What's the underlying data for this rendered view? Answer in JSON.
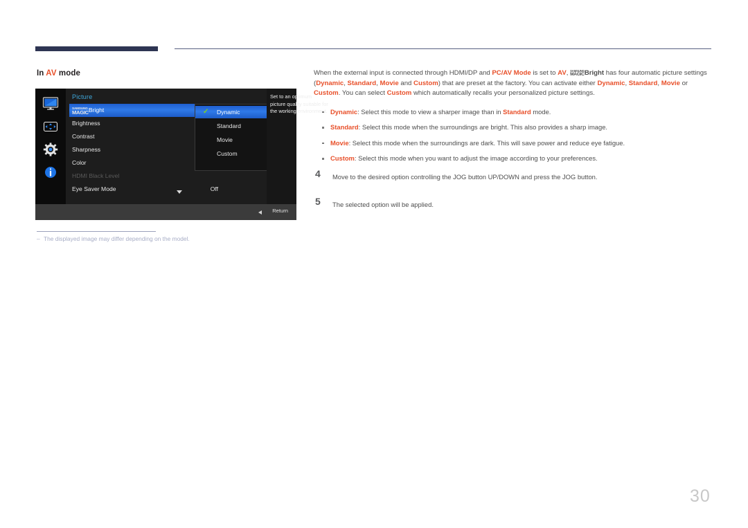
{
  "heading": {
    "prefix": "In ",
    "accent": "AV",
    "suffix": " mode"
  },
  "osd": {
    "title": "Picture",
    "sidebar_icons": [
      "monitor-icon",
      "screen-adjust-icon",
      "gear-icon",
      "info-icon"
    ],
    "menu_items": [
      {
        "label": "Bright",
        "logo": true,
        "logo_top": "SAMSUNG",
        "logo_bottom": "MAGIC",
        "state": "active",
        "value": ""
      },
      {
        "label": "Brightness",
        "state": "normal",
        "value": ""
      },
      {
        "label": "Contrast",
        "state": "normal",
        "value": ""
      },
      {
        "label": "Sharpness",
        "state": "normal",
        "value": ""
      },
      {
        "label": "Color",
        "state": "normal",
        "value": ""
      },
      {
        "label": "HDMI Black Level",
        "state": "disabled",
        "value": ""
      },
      {
        "label": "Eye Saver Mode",
        "state": "normal",
        "value": "Off"
      }
    ],
    "submenu_options": [
      {
        "label": "Dynamic",
        "selected": true
      },
      {
        "label": "Standard",
        "selected": false
      },
      {
        "label": "Movie",
        "selected": false
      },
      {
        "label": "Custom",
        "selected": false
      }
    ],
    "description": "Set to an optimum picture quality suitable for the working environment.",
    "footer_label": "Return",
    "scroll_indicator": "chevron-down-icon",
    "colors": {
      "highlight": "#2f7ae8",
      "check": "#7ed321",
      "title": "#3fa9dd",
      "background": "#1b1b1b"
    }
  },
  "footnote": {
    "dash": "‒",
    "text": "The displayed image may differ depending on the model."
  },
  "body": {
    "intro_parts": [
      {
        "t": "When the external input is connected through HDMI/DP and ",
        "hl": false
      },
      {
        "t": "PC/AV Mode",
        "hl": true
      },
      {
        "t": " is set to ",
        "hl": false
      },
      {
        "t": "AV",
        "hl": true
      },
      {
        "t": ", ",
        "hl": false
      },
      {
        "t": "MAGIC_LOGO",
        "hl": false
      },
      {
        "t": "Bright",
        "hl": false,
        "bold": true
      },
      {
        "t": " has four automatic picture settings (",
        "hl": false
      },
      {
        "t": "Dynamic",
        "hl": true
      },
      {
        "t": ", ",
        "hl": false
      },
      {
        "t": "Standard",
        "hl": true
      },
      {
        "t": ", ",
        "hl": false
      },
      {
        "t": "Movie",
        "hl": true
      },
      {
        "t": " and ",
        "hl": false
      },
      {
        "t": "Custom",
        "hl": true
      },
      {
        "t": ") that are preset at the factory. You can activate either ",
        "hl": false
      },
      {
        "t": "Dynamic",
        "hl": true
      },
      {
        "t": ", ",
        "hl": false
      },
      {
        "t": "Standard",
        "hl": true
      },
      {
        "t": ", ",
        "hl": false
      },
      {
        "t": "Movie",
        "hl": true
      },
      {
        "t": " or ",
        "hl": false
      },
      {
        "t": "Custom",
        "hl": true
      },
      {
        "t": ". You can select ",
        "hl": false
      },
      {
        "t": "Custom",
        "hl": true
      },
      {
        "t": " which automatically recalls your personalized picture settings.",
        "hl": false
      }
    ],
    "magic_logo_top": "SAMSUNG",
    "magic_logo_bottom": "MAGIC",
    "bullets": [
      {
        "term": "Dynamic",
        "rest_a": ": Select this mode to view a sharper image than in ",
        "term_b": "Standard",
        "rest_b": " mode."
      },
      {
        "term": "Standard",
        "rest_a": ": Select this mode when the surroundings are bright. This also provides a sharp image.",
        "term_b": "",
        "rest_b": ""
      },
      {
        "term": "Movie",
        "rest_a": ": Select this mode when the surroundings are dark. This will save power and reduce eye fatigue.",
        "term_b": "",
        "rest_b": ""
      },
      {
        "term": "Custom",
        "rest_a": ": Select this mode when you want to adjust the image according to your preferences.",
        "term_b": "",
        "rest_b": ""
      }
    ],
    "steps": [
      {
        "num": "4",
        "text": "Move to the desired option controlling the JOG button UP/DOWN and press the JOG button."
      },
      {
        "num": "5",
        "text": "The selected option will be applied."
      }
    ]
  },
  "page_number": "30",
  "colors": {
    "accent": "#e8502a",
    "rule_dark": "#2e3553",
    "rule_light": "#575f80",
    "body_text": "#4d4d4d"
  }
}
